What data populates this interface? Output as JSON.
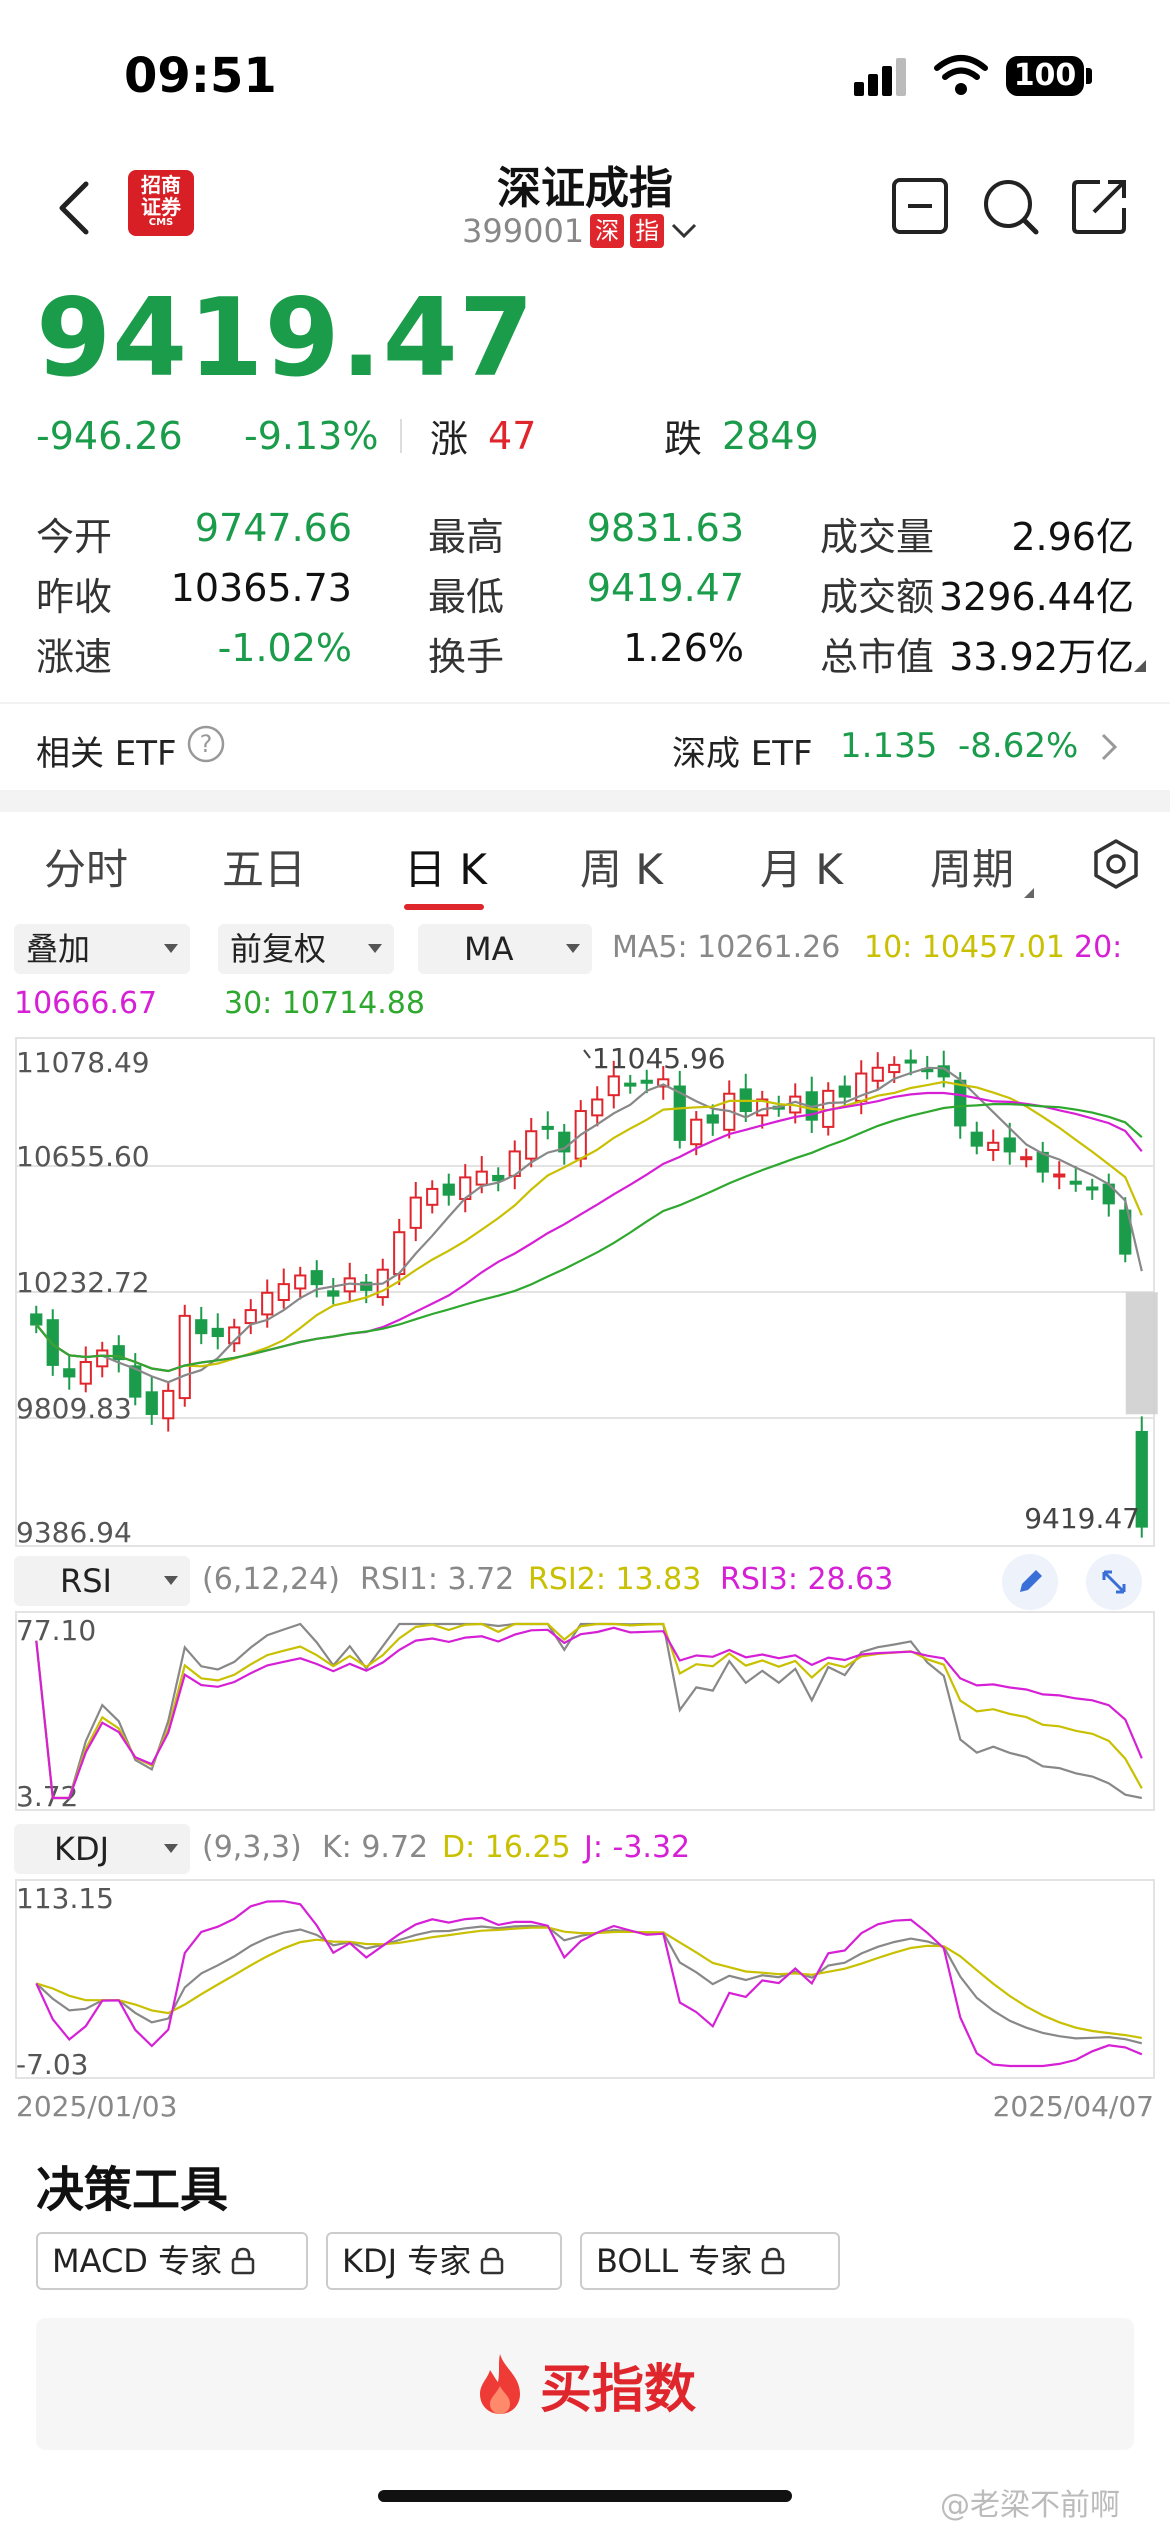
{
  "status_bar": {
    "time": "09:51",
    "battery": "100"
  },
  "header": {
    "title": "深证成指",
    "code": "399001",
    "tags": [
      "深",
      "指"
    ],
    "logo_text": [
      "招商",
      "证券",
      "CMS"
    ]
  },
  "quote": {
    "price": "9419.47",
    "change": "-946.26",
    "change_pct": "-9.13%",
    "up_label": "涨",
    "up_count": "47",
    "down_label": "跌",
    "down_count": "2849"
  },
  "stats": [
    {
      "label": "今开",
      "value": "9747.66",
      "color": "green"
    },
    {
      "label": "最高",
      "value": "9831.63",
      "color": "green"
    },
    {
      "label": "成交量",
      "value": "2.96亿",
      "color": "dark"
    },
    {
      "label": "昨收",
      "value": "10365.73",
      "color": "dark"
    },
    {
      "label": "最低",
      "value": "9419.47",
      "color": "green"
    },
    {
      "label": "成交额",
      "value": "3296.44亿",
      "color": "dark"
    },
    {
      "label": "涨速",
      "value": "-1.02%",
      "color": "green"
    },
    {
      "label": "换手",
      "value": "1.26%",
      "color": "dark"
    },
    {
      "label": "总市值",
      "value": "33.92万亿",
      "color": "dark"
    }
  ],
  "etf": {
    "label": "相关 ETF",
    "name": "深成 ETF",
    "price": "1.135",
    "change": "-8.62%"
  },
  "tabs": [
    "分时",
    "五日",
    "日 K",
    "周 K",
    "月 K",
    "周期"
  ],
  "chart_controls": {
    "overlay": "叠加",
    "adjust": "前复权",
    "indicator": "MA"
  },
  "ma_legend": {
    "ma5": "MA5: 10261.26",
    "ma10": "10: 10457.01",
    "ma20": "20: 10666.67",
    "ma30": "30: 10714.88"
  },
  "colors": {
    "up": "#e0262d",
    "down": "#1a9c4b",
    "ma5": "#888888",
    "ma10": "#c8c000",
    "ma20": "#d620d6",
    "ma30": "#2ea82e"
  },
  "chart_data": [
    {
      "type": "candlestick",
      "y_axis_labels": [
        "11078.49",
        "10655.60",
        "10232.72",
        "9809.83",
        "9386.94"
      ],
      "annotations": [
        "11045.96",
        "9419.47"
      ],
      "ylim": [
        9386.94,
        11078.49
      ],
      "close": [
        10120,
        9980,
        9940,
        9990,
        10030,
        10000,
        9870,
        9810,
        9890,
        10150,
        10090,
        10080,
        10110,
        10170,
        10230,
        10260,
        10290,
        10260,
        10220,
        10280,
        10240,
        10310,
        10440,
        10560,
        10590,
        10570,
        10630,
        10650,
        10620,
        10720,
        10790,
        10800,
        10720,
        10860,
        10900,
        10980,
        10950,
        10960,
        10970,
        10760,
        10830,
        10820,
        10920,
        10860,
        10900,
        10870,
        10910,
        10830,
        10930,
        10910,
        10990,
        11010,
        11020,
        11030,
        11000,
        10980,
        10810,
        10740,
        10750,
        10720,
        10700,
        10650,
        10640,
        10610,
        10590,
        10540,
        10365.73,
        9419.47
      ],
      "series": [
        {
          "name": "MA5",
          "values": "computed"
        },
        {
          "name": "10",
          "values": "computed"
        },
        {
          "name": "20",
          "values": "computed"
        },
        {
          "name": "30",
          "values": "computed"
        }
      ]
    },
    {
      "type": "line",
      "indicator": "RSI",
      "params": "(6,12,24)",
      "legend": [
        "RSI1: 3.72",
        "RSI2: 13.83",
        "RSI3: 28.63"
      ],
      "ylim_labels": [
        "77.10",
        "3.72"
      ]
    },
    {
      "type": "line",
      "indicator": "KDJ",
      "params": "(9,3,3)",
      "legend": [
        "K: 9.72",
        "D: 16.25",
        "J: -3.32"
      ],
      "ylim_labels": [
        "113.15",
        "-7.03"
      ],
      "x_labels": [
        "2025/01/03",
        "2025/04/07"
      ]
    }
  ],
  "tools": {
    "title": "决策工具",
    "buttons": [
      "MACD 专家",
      "KDJ 专家",
      "BOLL 专家"
    ],
    "buy": "买指数"
  },
  "watermark": "@老梁不前啊"
}
